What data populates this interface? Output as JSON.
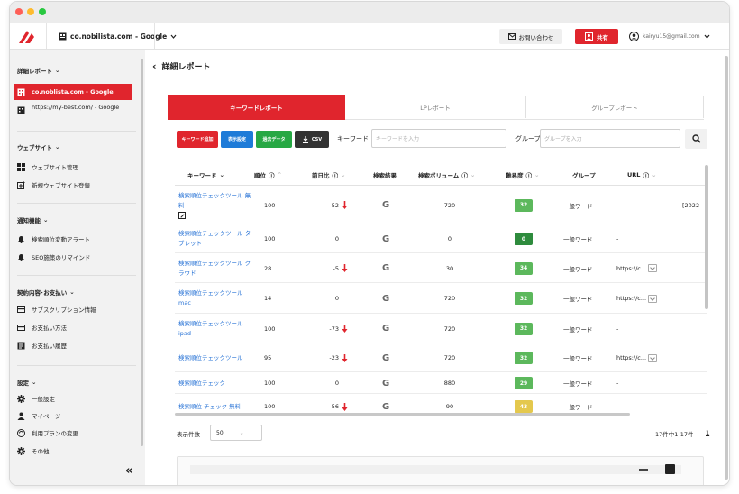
{
  "header": {
    "site": "co.nobilista.com - Google",
    "contact": "お問い合わせ",
    "share": "共有",
    "email": "kairyu15@gmail.com"
  },
  "sidebar": {
    "report_head": "詳細レポート",
    "sites": [
      {
        "label": "co.noblista.com - Google"
      },
      {
        "label": "https://my-best.com/ - Google"
      }
    ],
    "site_head": "ウェブサイト",
    "site_items": [
      {
        "label": "ウェブサイト管理"
      },
      {
        "label": "新規ウェブサイト登録"
      }
    ],
    "notif_head": "通知機能",
    "notif_items": [
      {
        "label": "検索順位変動アラート"
      },
      {
        "label": "SEO施策のリマインド"
      }
    ],
    "contract_head": "契約内容･お支払い",
    "contract_items": [
      {
        "label": "サブスクリプション情報"
      },
      {
        "label": "お支払い方法"
      },
      {
        "label": "お支払い履歴"
      }
    ],
    "settings_head": "設定",
    "settings_items": [
      {
        "label": "一般設定"
      },
      {
        "label": "マイページ"
      },
      {
        "label": "利用プランの変更"
      },
      {
        "label": "その他"
      }
    ]
  },
  "page": {
    "title": "詳細レポート"
  },
  "tabs": [
    "キーワードレポート",
    "LPレポート",
    "グループレポート"
  ],
  "toolbar": {
    "add": "キーワード追加",
    "display": "表示設定",
    "past": "過去データ",
    "csv": "CSV",
    "keyword_label": "キーワード",
    "keyword_placeholder": "キーワードを入力",
    "group_label": "グループ",
    "group_placeholder": "グループを入力"
  },
  "table": {
    "headers": [
      "キーワード",
      "順位",
      "前日比",
      "検索結果",
      "検索ボリューム",
      "難易度",
      "グループ",
      "URL"
    ],
    "extra_cell": "[2022-",
    "rows": [
      {
        "keyword": "検索順位チェックツール 無料",
        "rank": "100",
        "change": "-52",
        "down": true,
        "volume": "720",
        "difficulty": "32",
        "dcolor": "#5cb85c",
        "group": "一般ワード",
        "url": "-"
      },
      {
        "keyword": "検索順位チェックツール タブレット",
        "rank": "100",
        "change": "0",
        "down": false,
        "volume": "0",
        "difficulty": "0",
        "dcolor": "#2e8b3d",
        "group": "一般ワード",
        "url": "-"
      },
      {
        "keyword": "検索順位チェックツール クラウド",
        "rank": "28",
        "change": "-5",
        "down": true,
        "volume": "30",
        "difficulty": "34",
        "dcolor": "#5cb85c",
        "group": "一般ワード",
        "url": "https://c..."
      },
      {
        "keyword": "検索順位チェックツール mac",
        "rank": "14",
        "change": "0",
        "down": false,
        "volume": "720",
        "difficulty": "32",
        "dcolor": "#5cb85c",
        "group": "一般ワード",
        "url": "https://c..."
      },
      {
        "keyword": "検索順位チェックツール ipad",
        "rank": "100",
        "change": "-73",
        "down": true,
        "volume": "720",
        "difficulty": "32",
        "dcolor": "#5cb85c",
        "group": "一般ワード",
        "url": "-"
      },
      {
        "keyword": "検索順位チェックツール",
        "rank": "95",
        "change": "-23",
        "down": true,
        "volume": "720",
        "difficulty": "32",
        "dcolor": "#5cb85c",
        "group": "一般ワード",
        "url": "https://c..."
      },
      {
        "keyword": "検索順位チェック",
        "rank": "100",
        "change": "0",
        "down": false,
        "volume": "880",
        "difficulty": "29",
        "dcolor": "#5cb85c",
        "group": "一般ワード",
        "url": "-"
      },
      {
        "keyword": "検索順位 チェック 無料",
        "rank": "100",
        "change": "-56",
        "down": true,
        "volume": "90",
        "difficulty": "43",
        "dcolor": "#e4c84d",
        "group": "一般ワード",
        "url": "-"
      }
    ]
  },
  "footer": {
    "per_page_label": "表示件数",
    "per_page": "50",
    "summary": "17件中1-17件",
    "page": "1"
  },
  "colors": {
    "accent": "#e0252d",
    "link": "#2a74d6",
    "blue_btn": "#1e7bd8",
    "green_btn": "#27a844",
    "dark_btn": "#333333"
  }
}
